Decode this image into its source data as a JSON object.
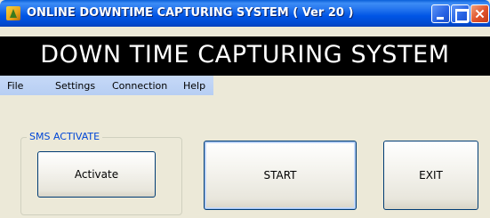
{
  "window": {
    "title": "ONLINE DOWNTIME CAPTURING SYSTEM ( Ver 20 )",
    "icon": "app-icon"
  },
  "banner": {
    "title": "DOWN TIME CAPTURING SYSTEM"
  },
  "menu": {
    "items": [
      {
        "label": "File"
      },
      {
        "label": "Settings"
      },
      {
        "label": "Connection"
      },
      {
        "label": "Help"
      }
    ]
  },
  "sms_group": {
    "legend": "SMS ACTIVATE",
    "activate_label": "Activate"
  },
  "actions": {
    "start_label": "START",
    "exit_label": "EXIT"
  },
  "colors": {
    "titlebar": "#0055e5",
    "banner_bg": "#000000",
    "banner_text": "#ffffff",
    "menubar": "#c6d9f7",
    "window_bg": "#ece9d8",
    "group_legend": "#0046d5"
  }
}
